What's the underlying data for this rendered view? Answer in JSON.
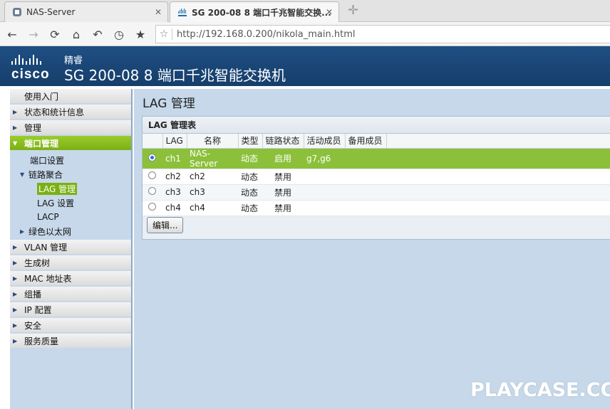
{
  "browser": {
    "tabs": [
      {
        "title": "NAS-Server",
        "active": false
      },
      {
        "title": "SG 200-08 8 端口千兆智能交换...",
        "active": true
      }
    ],
    "url": "http://192.168.0.200/nikola_main.html",
    "nav_icons": [
      "back-icon",
      "forward-icon",
      "reload-icon",
      "home-icon",
      "undo-icon",
      "history-icon",
      "bookmark-star-icon"
    ]
  },
  "header": {
    "logo_text": "cisco",
    "brand_sub": "精睿",
    "product_title": "SG 200-08 8 端口千兆智能交换机"
  },
  "sidebar": {
    "items": [
      {
        "label": "使用入门",
        "has_arrow": false
      },
      {
        "label": "状态和统计信息",
        "has_arrow": true
      },
      {
        "label": "管理",
        "has_arrow": true
      },
      {
        "label": "端口管理",
        "has_arrow": true,
        "active": true
      },
      {
        "label": "VLAN 管理",
        "has_arrow": true
      },
      {
        "label": "生成树",
        "has_arrow": true
      },
      {
        "label": "MAC 地址表",
        "has_arrow": true
      },
      {
        "label": "组播",
        "has_arrow": true
      },
      {
        "label": "IP 配置",
        "has_arrow": true
      },
      {
        "label": "安全",
        "has_arrow": true
      },
      {
        "label": "服务质量",
        "has_arrow": true
      }
    ],
    "port_mgmt_sub": {
      "port_settings": "端口设置",
      "link_aggregation": "链路聚合",
      "lag_management": "LAG 管理",
      "lag_settings": "LAG 设置",
      "lacp": "LACP",
      "green_ethernet": "绿色以太网"
    }
  },
  "main": {
    "page_title": "LAG 管理",
    "panel_title": "LAG 管理表",
    "columns": [
      "LAG",
      "名称",
      "类型",
      "链路状态",
      "活动成员",
      "备用成员"
    ],
    "rows": [
      {
        "lag": "ch1",
        "name": "NAS-Server",
        "type": "动态",
        "link": "启用",
        "active": "g7,g6",
        "standby": "",
        "selected": true
      },
      {
        "lag": "ch2",
        "name": "ch2",
        "type": "动态",
        "link": "禁用",
        "active": "",
        "standby": "",
        "selected": false
      },
      {
        "lag": "ch3",
        "name": "ch3",
        "type": "动态",
        "link": "禁用",
        "active": "",
        "standby": "",
        "selected": false
      },
      {
        "lag": "ch4",
        "name": "ch4",
        "type": "动态",
        "link": "禁用",
        "active": "",
        "standby": "",
        "selected": false
      }
    ],
    "edit_button": "编辑..."
  },
  "watermark": "PLAYCASE.COM",
  "colors": {
    "header_blue": "#1f4f83",
    "active_green": "#7bb014",
    "sidebar_bg": "#c6d8ea"
  }
}
